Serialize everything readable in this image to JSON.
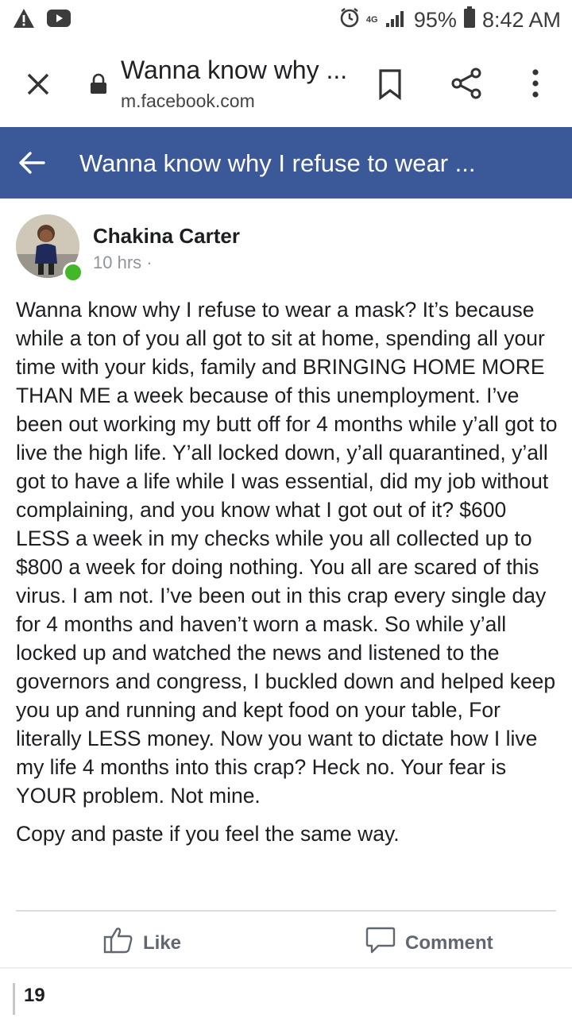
{
  "status_bar": {
    "battery": "95%",
    "time": "8:42 AM",
    "network": "4G",
    "icons": [
      "warning-icon",
      "youtube-icon",
      "alarm-icon",
      "signal-icon",
      "battery-icon"
    ]
  },
  "browser": {
    "tab_title": "Wanna know why ...",
    "url": "m.facebook.com",
    "icons": [
      "close-icon",
      "lock-icon",
      "bookmark-icon",
      "share-icon",
      "more-vert-icon"
    ]
  },
  "fb_header": {
    "title": "Wanna know why I refuse to wear ...",
    "back_icon": "back-arrow-icon",
    "color": "#3b5998"
  },
  "post": {
    "author": "Chakina Carter",
    "time": "10 hrs ·",
    "body": "Wanna know why I refuse to wear a mask? It’s because while a ton of you all got to sit at home, spending all your time with your kids, family and BRINGING HOME MORE THAN ME a week because of this unemployment. I’ve been out working my butt off for 4 months while y’all got to live the high life. Y’all locked down, y’all quarantined, y’all got to have a life while I was essential, did my job without complaining, and you know what I got out of it? $600 LESS a week in my checks while you all collected up to $800 a week for doing nothing. You all are scared of this virus. I am not. I’ve been out in this crap every single day for 4 months and haven’t worn a mask. So while y’all locked up and watched the news and listened to the governors and congress, I buckled down and helped keep you up and running and kept food on your table, For literally LESS money. Now you want to dictate how I live my life 4 months into this crap? Heck no. Your fear is YOUR problem. Not mine.",
    "body2": "Copy and paste if you feel the same way."
  },
  "actions": {
    "like": "Like",
    "comment": "Comment"
  },
  "footer": {
    "count": "19"
  }
}
